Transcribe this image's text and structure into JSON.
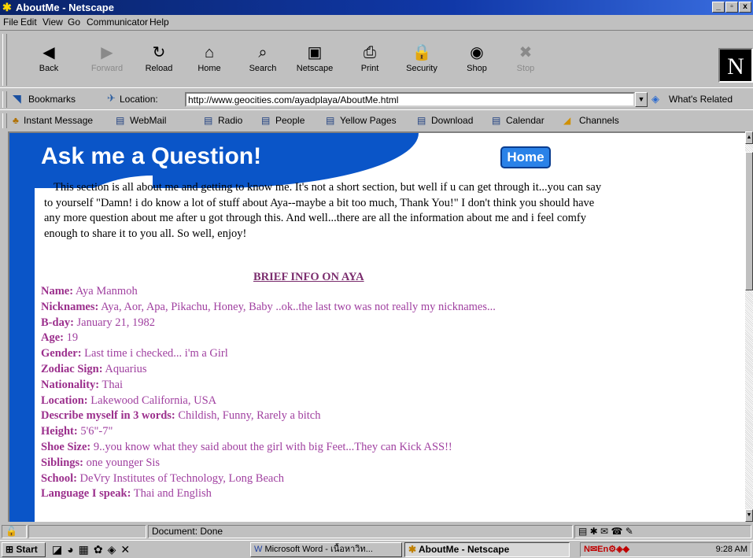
{
  "window": {
    "title": "AboutMe - Netscape",
    "min": "_",
    "max": "▫",
    "close": "x"
  },
  "menu": [
    "File",
    "Edit",
    "View",
    "Go",
    "Communicator",
    "Help"
  ],
  "nav": [
    {
      "label": "Back",
      "icon": "back-arrow-icon",
      "glyph": "◀",
      "enabled": true
    },
    {
      "label": "Forward",
      "icon": "forward-arrow-icon",
      "glyph": "▶",
      "enabled": false
    },
    {
      "label": "Reload",
      "icon": "reload-icon",
      "glyph": "↻",
      "enabled": true
    },
    {
      "label": "Home",
      "icon": "home-icon",
      "glyph": "⌂",
      "enabled": true
    },
    {
      "label": "Search",
      "icon": "search-icon",
      "glyph": "⌕",
      "enabled": true
    },
    {
      "label": "Netscape",
      "icon": "netscape-icon",
      "glyph": "▣",
      "enabled": true
    },
    {
      "label": "Print",
      "icon": "print-icon",
      "glyph": "⎙",
      "enabled": true
    },
    {
      "label": "Security",
      "icon": "lock-icon",
      "glyph": "🔒",
      "enabled": true
    },
    {
      "label": "Shop",
      "icon": "shop-icon",
      "glyph": "◉",
      "enabled": true
    },
    {
      "label": "Stop",
      "icon": "stop-icon",
      "glyph": "✖",
      "enabled": false
    }
  ],
  "location": {
    "bookmarks": "Bookmarks",
    "label": "Location:",
    "url": "http://www.geocities.com/ayadplaya/AboutMe.html",
    "related": "What's Related"
  },
  "personal": [
    "Instant Message",
    "WebMail",
    "Radio",
    "People",
    "Yellow Pages",
    "Download",
    "Calendar",
    "Channels"
  ],
  "page": {
    "title": "Ask me a Question!",
    "home": "Home",
    "intro": "This section is all about me and getting to know me.  It's not a short section, but well if u can get through it...you can say to yourself \"Damn! i do know a lot of stuff about Aya--maybe a bit too much, Thank You!\"  I don't think you should have any more question about me after u got through this.  And well...there are all the information about me and i feel comfy enough to share it to you all.  So well, enjoy!",
    "section": "BRIEF INFO ON AYA",
    "info": [
      {
        "k": "Name:",
        "v": "Aya Manmoh"
      },
      {
        "k": "Nicknames:",
        "v": "Aya, Aor, Apa, Pikachu, Honey, Baby ..ok..the last two was not really my nicknames..."
      },
      {
        "k": "B-day:",
        "v": "January 21, 1982"
      },
      {
        "k": "Age:",
        "v": "19"
      },
      {
        "k": "Gender:",
        "v": "Last time i checked... i'm a Girl"
      },
      {
        "k": "Zodiac Sign:",
        "v": "Aquarius"
      },
      {
        "k": "Nationality:",
        "v": "Thai"
      },
      {
        "k": "Location:",
        "v": "Lakewood California, USA"
      },
      {
        "k": "Describe myself in 3 words:",
        "v": "Childish, Funny, Rarely a bitch"
      },
      {
        "k": "Height:",
        "v": "5'6\"-7\""
      },
      {
        "k": "Shoe Size:",
        "v": "9..you know what they said about the girl with big Feet...They can Kick ASS!!"
      },
      {
        "k": "Siblings:",
        "v": "one younger Sis"
      },
      {
        "k": "School:",
        "v": "DeVry Institutes of Technology, Long Beach"
      },
      {
        "k": "Language I speak:",
        "v": "Thai and English"
      }
    ]
  },
  "status": {
    "text": "Document: Done"
  },
  "taskbar": {
    "start": "Start",
    "tasks": [
      "Microsoft Word - เนื้อหาวิท...",
      "AboutMe - Netscape"
    ],
    "time": "9:28 AM"
  },
  "colors": {
    "blue": "#0a55c8",
    "label": "#9b2f8c",
    "heading": "#7b2d6e"
  }
}
